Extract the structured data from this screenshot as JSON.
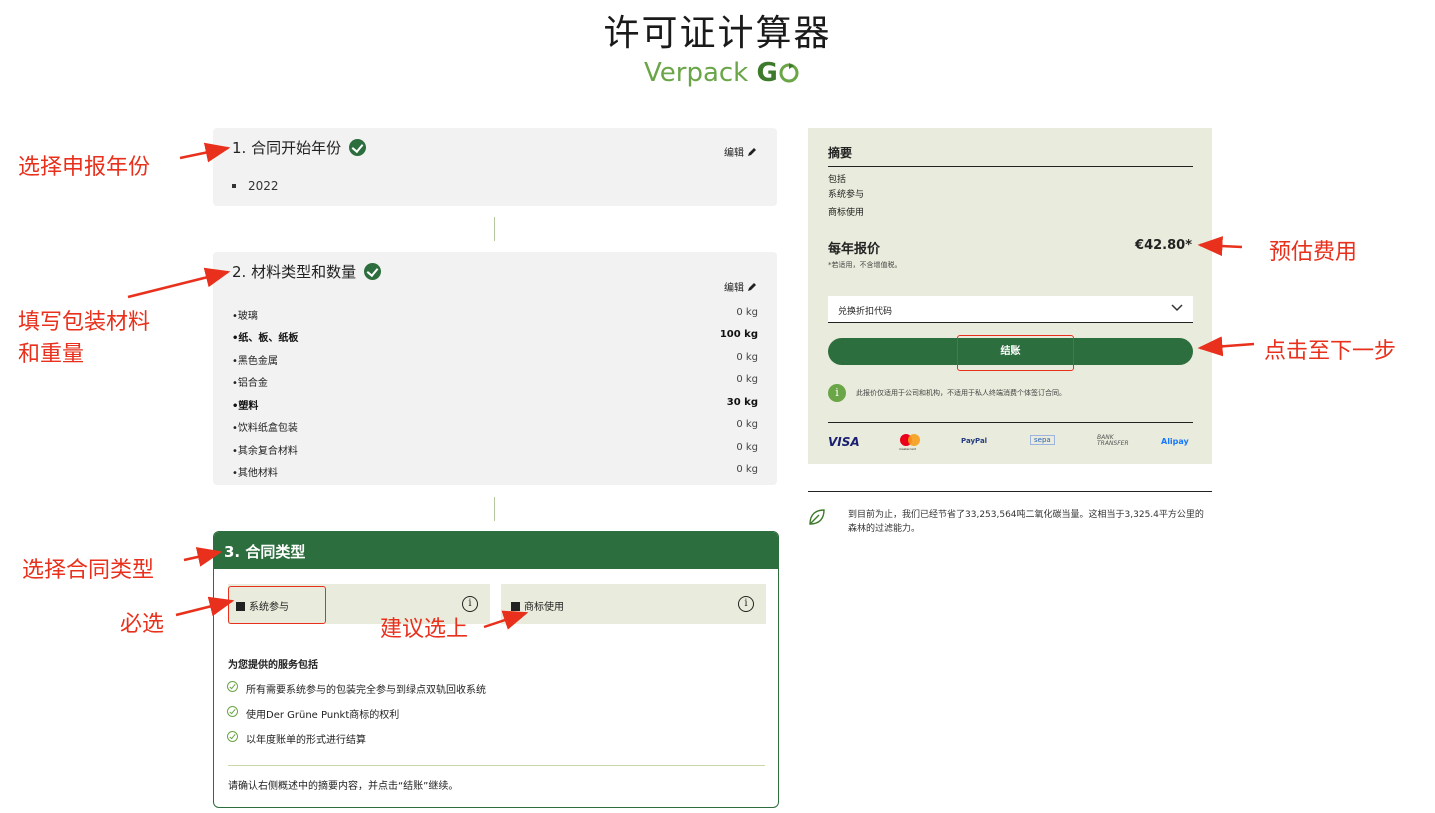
{
  "header": {
    "title": "许可证计算器",
    "logo_text": "Verpack",
    "logo_go": "G"
  },
  "step1": {
    "title": "1. 合同开始年份",
    "edit": "编辑",
    "year": "2022"
  },
  "step2": {
    "title": "2. 材料类型和数量",
    "edit": "编辑",
    "materials": [
      {
        "label": "•玻璃",
        "value": "0 kg"
      },
      {
        "label": "•纸、板、纸板",
        "value": "100 kg"
      },
      {
        "label": "•黑色金属",
        "value": "0 kg"
      },
      {
        "label": "•铝合金",
        "value": "0 kg"
      },
      {
        "label": "•塑料",
        "value": "30 kg"
      },
      {
        "label": "•饮料纸盒包装",
        "value": "0 kg"
      },
      {
        "label": "•其余复合材料",
        "value": "0 kg"
      },
      {
        "label": "•其他材料",
        "value": "0 kg"
      }
    ]
  },
  "step3": {
    "title": "3. 合同类型",
    "options": [
      {
        "label": "系统参与",
        "checked": true
      },
      {
        "label": "商标使用",
        "checked": true
      }
    ],
    "services_heading": "为您提供的服务包括",
    "services": [
      "所有需要系统参与的包装完全参与到绿点双轨回收系统",
      "使用Der Grüne Punkt商标的权利",
      "以年度账单的形式进行结算"
    ],
    "footer": "请确认右侧概述中的摘要内容，并点击“结账”继续。"
  },
  "summary": {
    "title": "摘要",
    "includes_label": "包括",
    "includes": [
      "系统参与",
      "商标使用"
    ],
    "annual_label": "每年报价",
    "price": "€42.80*",
    "tax_note": "*若适用，不含增值税。",
    "discount_placeholder": "兑换折扣代码",
    "checkout": "结账",
    "info_note": "此报价仅适用于公司和机构，不适用于私人终端消费个体签订合同。",
    "payments": [
      "VISA",
      "mastercard",
      "PayPal",
      "sepa",
      "BANK TRANSFER",
      "Alipay"
    ]
  },
  "co2_note": "到目前为止，我们已经节省了33,253,564吨二氧化碳当量。这相当于3,325.4平方公里的森林的过滤能力。",
  "annotations": {
    "a1": "选择申报年份",
    "a2_line1": "填写包装材料",
    "a2_line2": "和重量",
    "a3": "选择合同类型",
    "a4": "必选",
    "a5": "建议选上",
    "a6": "预估费用",
    "a7": "点击至下一步"
  },
  "colors": {
    "brand_green": "#2d6e3e",
    "summary_bg": "#e9ecdc",
    "annotation_red": "#e8301c"
  }
}
